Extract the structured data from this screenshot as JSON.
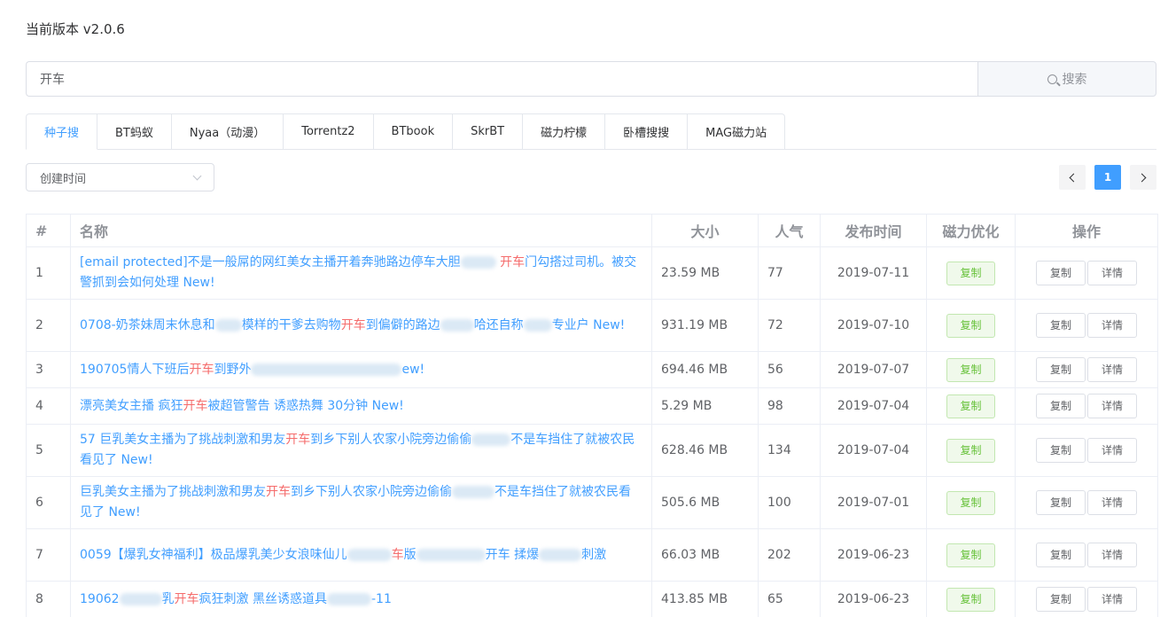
{
  "version": "当前版本 v2.0.6",
  "search": {
    "value": "开车",
    "button": "搜索"
  },
  "tabs": [
    "种子搜",
    "BT蚂蚁",
    "Nyaa（动漫）",
    "Torrentz2",
    "BTbook",
    "SkrBT",
    "磁力柠檬",
    "卧槽搜搜",
    "MAG磁力站"
  ],
  "active_tab": 0,
  "sort": {
    "value": "创建时间"
  },
  "pagination": {
    "current": "1"
  },
  "table": {
    "headers": [
      "#",
      "名称",
      "大小",
      "人气",
      "发布时间",
      "磁力优化",
      "操作"
    ],
    "copy_tag": "复制",
    "copy_button": "复制",
    "detail_button": "详情",
    "rows": [
      {
        "index": "1",
        "name_parts": [
          "[email protected]不是一般屌的网红美女主播开着奔驰路边停车大胆",
          "开车",
          "门勾搭过司机。被交警抓到会如何处理 New!"
        ],
        "size": "23.59 MB",
        "pop": "77",
        "date": "2019-07-11"
      },
      {
        "index": "2",
        "name_parts": [
          "0708-奶茶妹周末休息和",
          "模样的干爹去购物",
          "开车",
          "到偏僻的路边",
          "哈还自称",
          "专业户 New!"
        ],
        "size": "931.19 MB",
        "pop": "72",
        "date": "2019-07-10"
      },
      {
        "index": "3",
        "name_parts": [
          "190705情人下班后",
          "开车",
          "到野外",
          "ew!"
        ],
        "size": "694.46 MB",
        "pop": "56",
        "date": "2019-07-07"
      },
      {
        "index": "4",
        "name_parts": [
          "漂亮美女主播 疯狂",
          "开车",
          "被超管警告 诱惑热舞 30分钟 New!"
        ],
        "size": "5.29 MB",
        "pop": "98",
        "date": "2019-07-04"
      },
      {
        "index": "5",
        "name_parts": [
          "57 巨乳美女主播为了挑战刺激和男友",
          "开车",
          "到乡下别人农家小院旁边偷偷",
          "不是车挡住了就被农民看见了 New!"
        ],
        "size": "628.46 MB",
        "pop": "134",
        "date": "2019-07-04"
      },
      {
        "index": "6",
        "name_parts": [
          "巨乳美女主播为了挑战刺激和男友",
          "开车",
          "到乡下别人农家小院旁边偷偷",
          "不是车挡住了就被农民看见了 New!"
        ],
        "size": "505.6 MB",
        "pop": "100",
        "date": "2019-07-01"
      },
      {
        "index": "7",
        "name_parts": [
          "0059【爆乳女神福利】极品爆乳美少女浪味仙儿",
          "车",
          "版",
          "开车 揉爆",
          "刺激"
        ],
        "size": "66.03 MB",
        "pop": "202",
        "date": "2019-06-23"
      },
      {
        "index": "8",
        "name_parts": [
          "19062",
          "乳",
          "开车",
          "疯狂刺激 黑丝诱惑道具",
          "-11"
        ],
        "size": "413.85 MB",
        "pop": "65",
        "date": "2019-06-23"
      }
    ]
  }
}
